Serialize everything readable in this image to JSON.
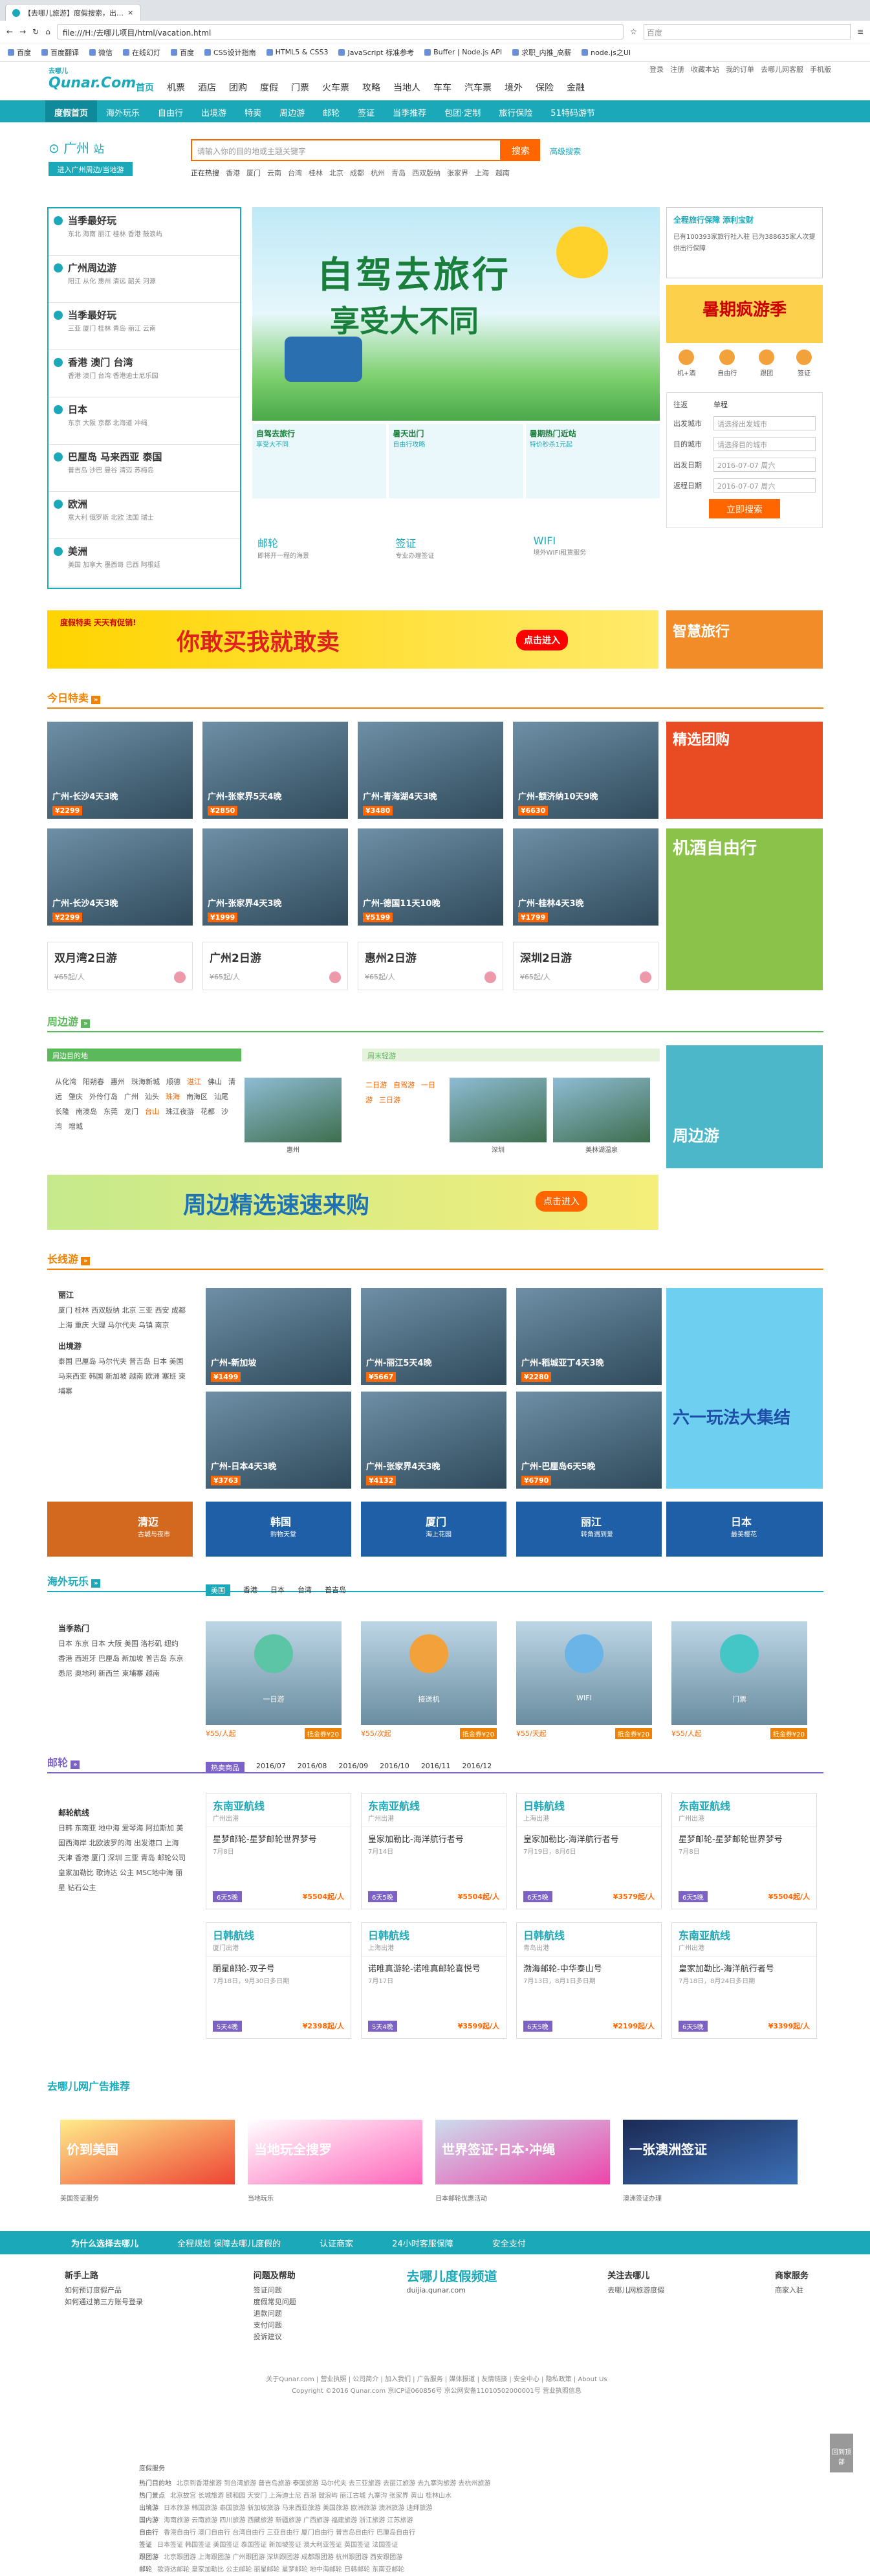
{
  "browser": {
    "tab_title": "【去哪儿旅游】度假搜索，出…",
    "address": "file:///H:/去哪儿项目/html/vacation.html",
    "search_placeholder": "百度",
    "bookmarks": [
      "百度",
      "百度翻译",
      "微信",
      "在线幻灯",
      "百度",
      "CSS设计指南",
      "HTML5 & CSS3",
      "JavaScript 标准参考",
      "Buffer | Node.js API",
      "求职_内推_高薪",
      "node.js之UI"
    ]
  },
  "site": {
    "logo": "Qunar.Com",
    "logo_sub": "去哪儿",
    "toplinks": [
      "登录",
      "注册",
      "收藏本站",
      "我的订单",
      "去哪儿网客服",
      "手机版"
    ],
    "nav": [
      "首页",
      "机票",
      "酒店",
      "团购",
      "度假",
      "门票",
      "火车票",
      "攻略",
      "当地人",
      "车车",
      "汽车票",
      "境外",
      "保险",
      "金融"
    ],
    "subnav": [
      "度假首页",
      "海外玩乐",
      "自由行",
      "出境游",
      "特卖",
      "周边游",
      "邮轮",
      "签证",
      "当季推荐",
      "包团·定制",
      "旅行保险",
      "51特码游节"
    ]
  },
  "search": {
    "city": "广州",
    "city_sub": "站",
    "city_btn": "进入广州周边/当地游",
    "placeholder": "请输入你的目的地或主题关键字",
    "button": "搜索",
    "advanced": "高级搜索",
    "hot_label": "正在热搜",
    "hot": [
      "香港",
      "厦门",
      "云南",
      "台湾",
      "桂林",
      "北京",
      "成都",
      "杭州",
      "青岛",
      "西双版纳",
      "张家界",
      "上海",
      "越南"
    ]
  },
  "sidemenu": [
    {
      "title": "当季最好玩",
      "sub": "东北 海南 丽江 桂林 香港 鼓浪屿"
    },
    {
      "title": "广州周边游",
      "sub": "阳江 从化 惠州 清远 韶关 河源"
    },
    {
      "title": "当季最好玩",
      "sub": "三亚 厦门 桂林 青岛 丽江 云南"
    },
    {
      "title": "香港 澳门 台湾",
      "sub": "香港 澳门 台湾 香港迪士尼乐园"
    },
    {
      "title": "日本",
      "sub": "东京 大阪 京都 北海道 冲绳"
    },
    {
      "title": "巴厘岛 马来西亚 泰国",
      "sub": "普吉岛 沙巴 曼谷 清迈 苏梅岛"
    },
    {
      "title": "欧洲",
      "sub": "意大利 俄罗斯 北欧 法国 瑞士"
    },
    {
      "title": "美洲",
      "sub": "美国 加拿大 墨西哥 巴西 阿根廷"
    }
  ],
  "banner": {
    "line1": "自驾去旅行",
    "line2": "享受大不同"
  },
  "minibanners": [
    {
      "b": "自驾去旅行",
      "s": "享受大不同"
    },
    {
      "b": "暑天出门",
      "s": "自由行攻略"
    },
    {
      "b": "暑期热门近站",
      "s": "特价秒杀1元起"
    }
  ],
  "services": [
    {
      "t": "邮轮",
      "s": "即将开一程的海景"
    },
    {
      "t": "签证",
      "s": "专业办理签证"
    },
    {
      "t": "WIFI",
      "s": "境外WIFI租赁服务"
    }
  ],
  "right": {
    "guarantee_title": "全程旅行保障 添利宝财",
    "guarantee_text": "已有100393家旅行社入驻 已为388635家人次提供出行保障",
    "summer": "暑期疯游季",
    "tabs": [
      "机+酒",
      "自由行",
      "跟团",
      "签证"
    ],
    "form": {
      "from_label": "出发城市",
      "from_placeholder": "请选择出发城市",
      "to_label": "目的城市",
      "to_placeholder": "请选择目的城市",
      "date1_label": "出发日期",
      "date1": "2016-07-07 周六",
      "date2_label": "返程日期",
      "date2": "2016-07-07 周六",
      "type_label": "往返",
      "type": "单程",
      "button": "立即搜索"
    }
  },
  "ads": {
    "strip_text": "你敢买我就敢卖",
    "strip_small": "度假特卖 天天有促销!",
    "strip_btn": "点击进入",
    "small": "智慧旅行"
  },
  "sec_today": {
    "title": "今日特卖",
    "items": [
      {
        "cap": "广州-长沙4天3晚",
        "price": "¥2299"
      },
      {
        "cap": "广州-张家界5天4晚",
        "price": "¥2850"
      },
      {
        "cap": "广州-青海湖4天3晚",
        "price": "¥3480"
      },
      {
        "cap": "广州-额济纳10天9晚",
        "price": "¥6630"
      },
      {
        "cap": "广州-长沙4天3晚",
        "price": "¥2299"
      },
      {
        "cap": "广州-张家界4天3晚",
        "price": "¥1999"
      },
      {
        "cap": "广州-德国11天10晚",
        "price": "¥5199"
      },
      {
        "cap": "广州-桂林4天3晚",
        "price": "¥1799"
      }
    ],
    "side1": "精选团购",
    "side2": "机酒自由行",
    "cards": [
      {
        "t": "双月湾2日游",
        "old": "¥65",
        "p": "起/人"
      },
      {
        "t": "广州2日游",
        "old": "¥65",
        "p": "起/人"
      },
      {
        "t": "惠州2日游",
        "old": "¥65",
        "p": "起/人"
      },
      {
        "t": "深圳2日游",
        "old": "¥65",
        "p": "起/人"
      }
    ]
  },
  "sec_around": {
    "title": "周边游",
    "tabs": [
      "周边目的地",
      "周末轻游"
    ],
    "places": [
      "从化湾",
      "阳朔春",
      "惠州",
      "珠海新城",
      "顺德",
      "湛江",
      "佛山",
      "清远",
      "肇庆",
      "外伶仃岛",
      "广州",
      "汕头",
      "珠海",
      "南海区",
      "汕尾",
      "长隆",
      "南澳岛",
      "东莞",
      "龙门",
      "台山",
      "珠江夜游",
      "花都",
      "沙湾",
      "增城"
    ],
    "thumbs": [
      "惠州",
      "深圳",
      "美林湖温泉"
    ],
    "mini": [
      "二日游",
      "自驾游",
      "一日游",
      "三日游"
    ],
    "banner": "周边精选速速来购",
    "btn": "点击进入",
    "side": "周边游"
  },
  "sec_long": {
    "title": "长线游",
    "left": [
      {
        "h": "丽江",
        "items": "厦门 桂林 西双版纳 北京 三亚 西安 成都 上海 重庆 大理 马尔代夫 乌镇 南京"
      },
      {
        "h": "出境游",
        "items": "泰国 巴厘岛 马尔代夫 普吉岛 日本 美国 马来西亚 韩国 新加坡 越南 欧洲 塞班 柬埔寨"
      }
    ],
    "photos": [
      {
        "cap": "广州-新加坡",
        "price": "¥1499"
      },
      {
        "cap": "广州-丽江5天4晚",
        "price": "¥5667"
      },
      {
        "cap": "广州-稻城亚丁4天3晚",
        "price": "¥2280"
      },
      {
        "cap": "广州-日本4天3晚",
        "price": "¥3763"
      },
      {
        "cap": "广州-张家界4天3晚",
        "price": "¥4132"
      },
      {
        "cap": "广州-巴厘岛6天5晚",
        "price": "¥6790"
      }
    ],
    "blocks": [
      {
        "b": "清迈",
        "s": "古城与夜市"
      },
      {
        "b": "韩国",
        "s": "购物天堂"
      },
      {
        "b": "厦门",
        "s": "海上花园"
      },
      {
        "b": "丽江",
        "s": "转角遇到爱"
      },
      {
        "b": "日本",
        "s": "最美樱花"
      }
    ],
    "side": "六一玩法大集结"
  },
  "sec_abroad": {
    "title": "海外玩乐",
    "tabs": [
      "美国",
      "香港",
      "日本",
      "台湾",
      "普吉岛"
    ],
    "left": {
      "h": "当季热门",
      "items": "日本 东京 日本 大阪 美国 洛杉矶 纽约 香港 西班牙 巴厘岛 新加坡 普吉岛 东京 悉尼 奥地利 新西兰 柬埔寨 越南"
    },
    "items": [
      {
        "lab": "一日游",
        "price": "¥55/人起",
        "tag": "抵金券¥20"
      },
      {
        "lab": "接送机",
        "price": "¥55/次起",
        "tag": "抵金券¥20"
      },
      {
        "lab": "WIFI",
        "price": "¥55/天起",
        "tag": "抵金券¥20"
      },
      {
        "lab": "门票",
        "price": "¥55/人起",
        "tag": "抵金券¥20"
      }
    ]
  },
  "sec_cruise": {
    "title": "邮轮",
    "tabs": [
      "热卖商品",
      "2016/07",
      "2016/08",
      "2016/09",
      "2016/10",
      "2016/11",
      "2016/12"
    ],
    "left": {
      "h": "邮轮航线",
      "items": "日韩 东南亚 地中海 爱琴海 阿拉斯加 美国西海岸 北欧波罗的海 出发港口 上海 天津 香港 厦门 深圳 三亚 青岛 邮轮公司 皇家加勒比 歌诗达 公主 MSC地中海 丽星 钻石公主"
    },
    "cards": [
      {
        "h": "东南亚航线",
        "hs": "广州出港",
        "n": "星梦邮轮-星梦邮轮世界梦号",
        "d": "7月8日",
        "tag": "6天5晚",
        "p": "¥5504起/人"
      },
      {
        "h": "东南亚航线",
        "hs": "广州出港",
        "n": "皇家加勒比-海洋航行者号",
        "d": "7月14日",
        "tag": "6天5晚",
        "p": "¥5504起/人"
      },
      {
        "h": "日韩航线",
        "hs": "上海出港",
        "n": "皇家加勒比-海洋航行者号",
        "d": "7月19日，8月6日",
        "tag": "6天5晚",
        "p": "¥3579起/人"
      },
      {
        "h": "东南亚航线",
        "hs": "广州出港",
        "n": "星梦邮轮-星梦邮轮世界梦号",
        "d": "7月8日",
        "tag": "6天5晚",
        "p": "¥5504起/人"
      },
      {
        "h": "日韩航线",
        "hs": "厦门出港",
        "n": "丽星邮轮-双子号",
        "d": "7月18日，9月30日多日期",
        "tag": "5天4晚",
        "p": "¥2398起/人"
      },
      {
        "h": "日韩航线",
        "hs": "上海出港",
        "n": "诺唯真游轮-诺唯真邮轮喜悦号",
        "d": "7月17日",
        "tag": "5天4晚",
        "p": "¥3599起/人"
      },
      {
        "h": "日韩航线",
        "hs": "青岛出港",
        "n": "渤海邮轮-中华泰山号",
        "d": "7月13日，8月1日多日期",
        "tag": "6天5晚",
        "p": "¥2199起/人"
      },
      {
        "h": "东南亚航线",
        "hs": "广州出港",
        "n": "皇家加勒比-海洋航行者号",
        "d": "7月18日，8月24日多日期",
        "tag": "6天5晚",
        "p": "¥3399起/人"
      }
    ]
  },
  "sec_promo": {
    "title": "去哪儿网广告推荐",
    "items": [
      {
        "t": "价到美国",
        "c": "美国签证服务"
      },
      {
        "t": "当地玩全搜罗",
        "c": "当地玩乐"
      },
      {
        "t": "世界签证·日本·冲绳",
        "c": "日本邮轮优惠活动"
      },
      {
        "t": "一张澳洲签证",
        "c": "澳洲签证办理"
      }
    ]
  },
  "footer": {
    "bar": [
      "为什么选择去哪儿",
      "全程规划 保障去哪儿度假的",
      "认证商家",
      "24小时客服保障",
      "安全支付"
    ],
    "cols": [
      {
        "h": "新手上路",
        "items": [
          "如何预订度假产品",
          "如何通过第三方账号登录"
        ]
      },
      {
        "h": "问题及帮助",
        "items": [
          "签证问题",
          "度假常见问题",
          "退款问题",
          "支付问题",
          "投诉建议"
        ]
      },
      {
        "h": "去哪儿度假频道",
        "items": [
          "duijia.qunar.com"
        ]
      },
      {
        "h": "关注去哪儿",
        "items": [
          "去哪儿网旅游度假"
        ]
      },
      {
        "h": "商家服务",
        "items": [
          "商家入驻"
        ]
      }
    ],
    "copy1": "关于Qunar.com | 营业执照 | 公司简介 | 加入我们 | 广告服务 | 媒体报道 | 友情链接 | 安全中心 | 隐私政策 | About Us",
    "copy2": "Copyright ©2016 Qunar.com 京ICP证060856号 京公网安备11010502000001号 营业执照信息",
    "links_head": "度假服务",
    "links": [
      {
        "k": "热门目的地",
        "v": "北京到香港旅游 到台湾旅游 普吉岛旅游 泰国旅游 马尔代夫 去三亚旅游 去丽江旅游 去九寨沟旅游 去杭州旅游"
      },
      {
        "k": "热门景点",
        "v": "北京故宫 长城旅游 颐和园 天安门 上海迪士尼 西湖 鼓浪屿 丽江古城 九寨沟 张家界 黄山 桂林山水"
      },
      {
        "k": "出境游",
        "v": "日本旅游 韩国旅游 泰国旅游 新加坡旅游 马来西亚旅游 美国旅游 欧洲旅游 澳洲旅游 迪拜旅游"
      },
      {
        "k": "国内游",
        "v": "海南旅游 云南旅游 四川旅游 西藏旅游 新疆旅游 广西旅游 福建旅游 浙江旅游 江苏旅游"
      },
      {
        "k": "自由行",
        "v": "香港自由行 澳门自由行 台湾自由行 三亚自由行 厦门自由行 普吉岛自由行 巴厘岛自由行"
      },
      {
        "k": "签证",
        "v": "日本签证 韩国签证 美国签证 泰国签证 新加坡签证 澳大利亚签证 英国签证 法国签证"
      },
      {
        "k": "跟团游",
        "v": "北京跟团游 上海跟团游 广州跟团游 深圳跟团游 成都跟团游 杭州跟团游 西安跟团游"
      },
      {
        "k": "邮轮",
        "v": "歌诗达邮轮 皇家加勒比 公主邮轮 丽星邮轮 星梦邮轮 地中海邮轮 日韩邮轮 东南亚邮轮"
      }
    ],
    "backtop": "回到顶部"
  }
}
